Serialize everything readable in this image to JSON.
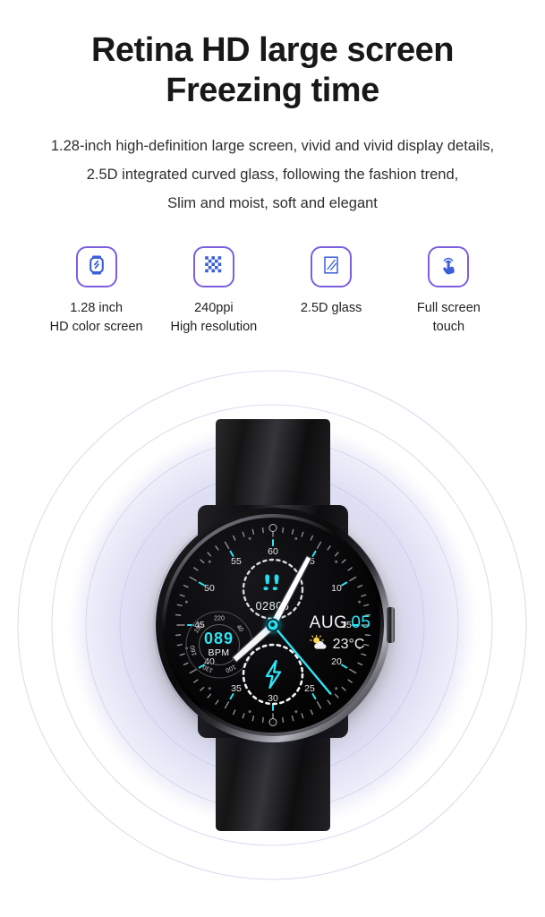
{
  "header": {
    "title_lines": [
      "Retina HD large screen",
      "Freezing time"
    ],
    "description_lines": [
      "1.28-inch high-definition large screen, vivid and vivid display details,",
      "2.5D integrated curved glass, following the fashion trend,",
      "Slim and moist, soft and elegant"
    ]
  },
  "features": [
    {
      "icon": "smartwatch-icon",
      "label": "1.28 inch\nHD color screen"
    },
    {
      "icon": "pixel-grid-icon",
      "label": "240ppi\nHigh resolution"
    },
    {
      "icon": "glass-pane-icon",
      "label": "2.5D glass"
    },
    {
      "icon": "touch-hand-icon",
      "label": "Full screen\ntouch"
    }
  ],
  "watch": {
    "minute_scale": [
      "60",
      "05",
      "10",
      "15",
      "20",
      "25",
      "30",
      "35",
      "40",
      "45",
      "50",
      "55"
    ],
    "steps": {
      "icon": "footsteps-icon",
      "value": "02805"
    },
    "heart_rate": {
      "value": "089",
      "unit": "BPM",
      "scale": [
        "220",
        "40",
        "70",
        "100",
        "130",
        "160",
        "190"
      ]
    },
    "date": {
      "month": "AUG",
      "day": "05"
    },
    "weather": {
      "icon": "sun-behind-cloud-icon",
      "temperature": "23°C"
    },
    "activity": {
      "icon": "lightning-bolt-icon"
    },
    "hands": {
      "hour_deg": 228,
      "minute_deg": 28,
      "second_deg": 140
    },
    "button": "side-crown-button"
  },
  "colors": {
    "icon_border": "#7b5fe0",
    "icon_fill": "#3b5fd9",
    "watch_accent": "#2fe3f2",
    "halo": "#c4c4eb",
    "title": "#181818"
  }
}
